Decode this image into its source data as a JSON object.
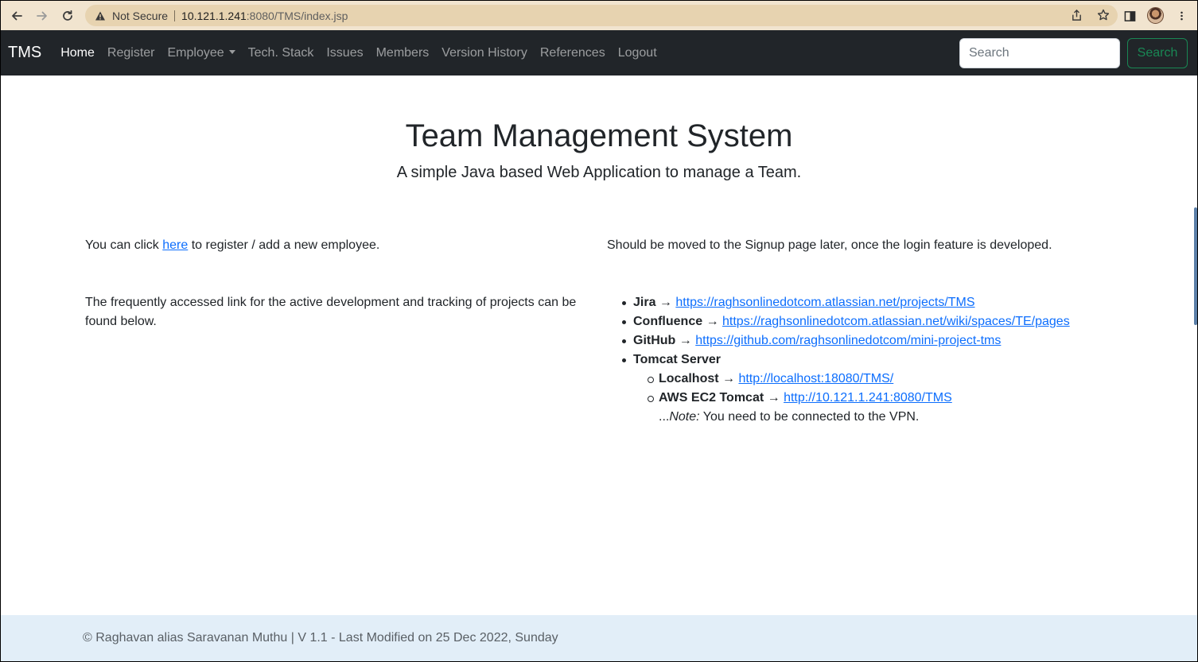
{
  "browser": {
    "security_label": "Not Secure",
    "url_host": "10.121.1.241",
    "url_rest": ":8080/TMS/index.jsp"
  },
  "navbar": {
    "brand": "TMS",
    "items": [
      {
        "label": "Home",
        "active": true
      },
      {
        "label": "Register"
      },
      {
        "label": "Employee",
        "dropdown": true
      },
      {
        "label": "Tech. Stack"
      },
      {
        "label": "Issues"
      },
      {
        "label": "Members"
      },
      {
        "label": "Version History"
      },
      {
        "label": "References"
      },
      {
        "label": "Logout"
      }
    ],
    "search_placeholder": "Search",
    "search_button": "Search"
  },
  "hero": {
    "title": "Team Management System",
    "subtitle": "A simple Java based Web Application to manage a Team."
  },
  "left": {
    "register_before": "You can click ",
    "register_link": "here",
    "register_after": " to register / add a new employee.",
    "links_intro": "The frequently accessed link for the active development and tracking of projects can be found below."
  },
  "right": {
    "signup_note": "Should be moved to the Signup page later, once the login feature is developed.",
    "arrow": " → ",
    "links": [
      {
        "name": "Jira",
        "url": "https://raghsonlinedotcom.atlassian.net/projects/TMS"
      },
      {
        "name": "Confluence",
        "url": "https://raghsonlinedotcom.atlassian.net/wiki/spaces/TE/pages"
      },
      {
        "name": "GitHub",
        "url": "https://github.com/raghsonlinedotcom/mini-project-tms"
      }
    ],
    "tomcat_label": "Tomcat Server",
    "tomcat_links": [
      {
        "name": "Localhost",
        "url": "http://localhost:18080/TMS/"
      },
      {
        "name": "AWS EC2 Tomcat",
        "url": "http://10.121.1.241:8080/TMS"
      }
    ],
    "note_prefix": "...",
    "note_label": "Note:",
    "note_text": " You need to be connected to the VPN."
  },
  "footer": {
    "text": "© Raghavan alias Saravanan Muthu | V 1.1 - Last Modified on 25 Dec 2022, Sunday"
  }
}
